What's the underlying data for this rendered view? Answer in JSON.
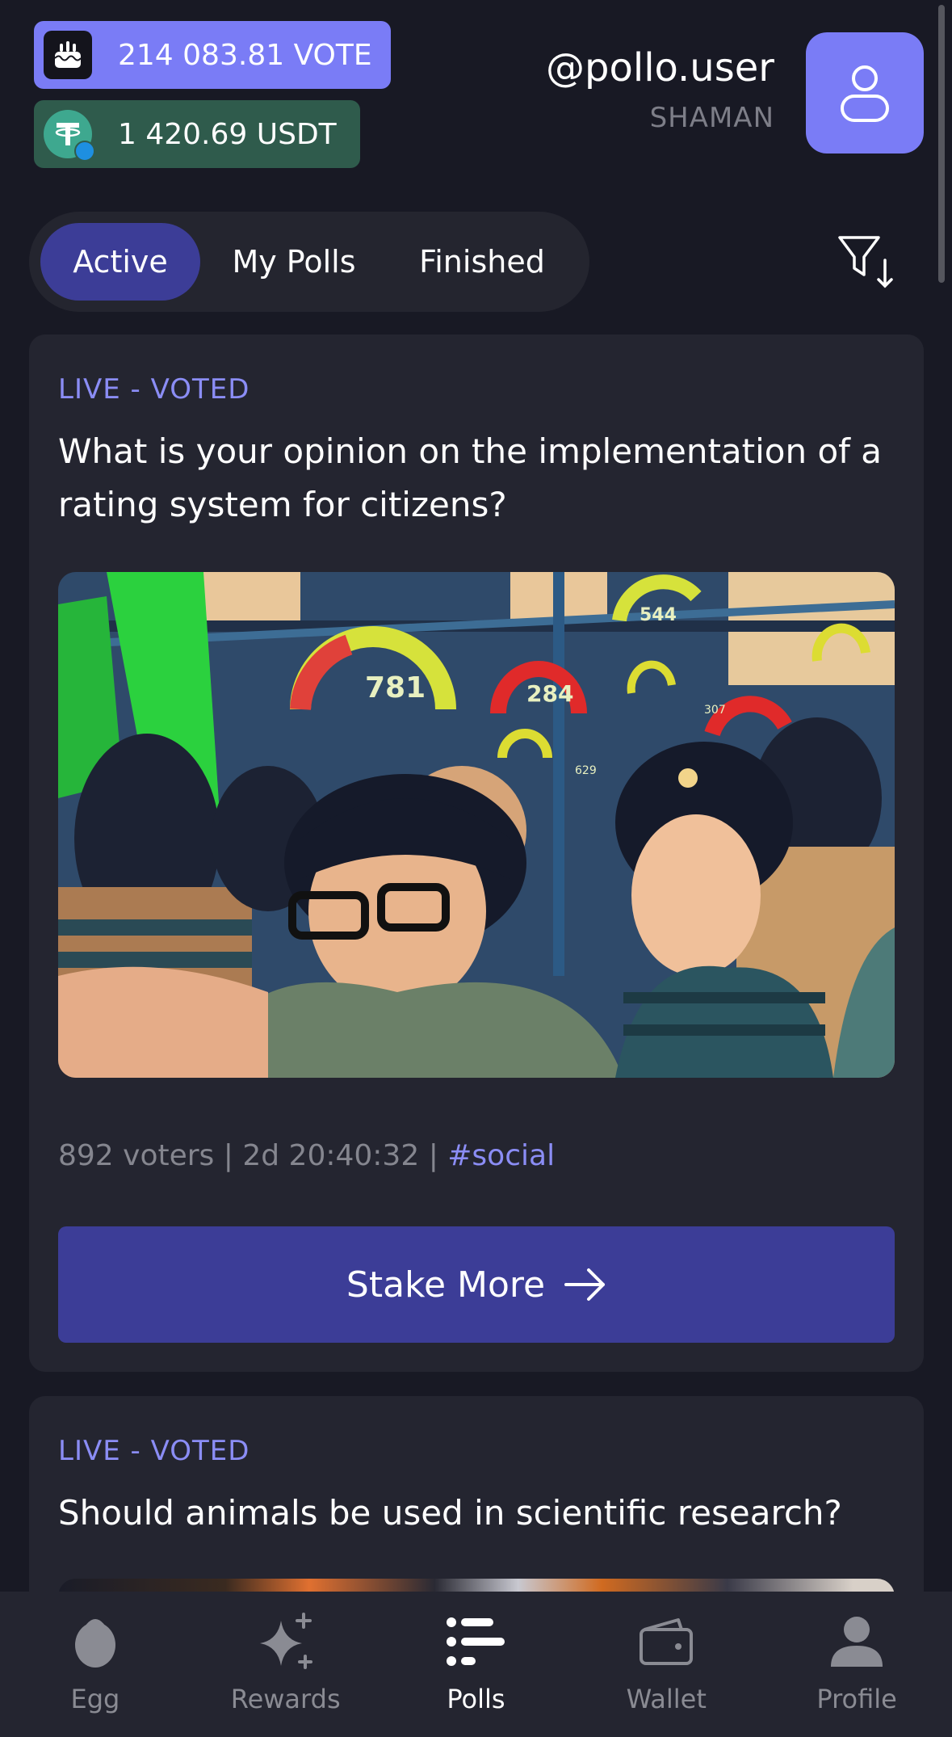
{
  "header": {
    "vote_balance": "214 083.81 VOTE",
    "usdt_balance": "1 420.69 USDT",
    "username": "@pollo.user",
    "rank": "SHAMAN"
  },
  "tabs": [
    {
      "label": "Active",
      "active": true
    },
    {
      "label": "My Polls",
      "active": false
    },
    {
      "label": "Finished",
      "active": false
    }
  ],
  "polls": [
    {
      "status": "LIVE - VOTED",
      "question": "What is your opinion on the implementation of a rating system for citizens?",
      "image_scores": [
        "544",
        "781",
        "284",
        "629",
        "307"
      ],
      "voters": "892 voters",
      "time_left": "2d 20:40:32",
      "tag": "#social",
      "action_label": "Stake More"
    },
    {
      "status": "LIVE - VOTED",
      "question": "Should animals be used in scientific research?"
    }
  ],
  "bottom_nav": [
    {
      "label": "Egg",
      "icon": "egg-icon",
      "active": false
    },
    {
      "label": "Rewards",
      "icon": "sparkle-icon",
      "active": false
    },
    {
      "label": "Polls",
      "icon": "polls-icon",
      "active": true
    },
    {
      "label": "Wallet",
      "icon": "wallet-icon",
      "active": false
    },
    {
      "label": "Profile",
      "icon": "person-icon",
      "active": false
    }
  ],
  "colors": {
    "background": "#181924",
    "card": "#242530",
    "accent": "#7a7cf6",
    "accent_dark": "#3c3d97",
    "usdt_pill": "#2f5b4c",
    "status_text": "#8b8df5"
  }
}
